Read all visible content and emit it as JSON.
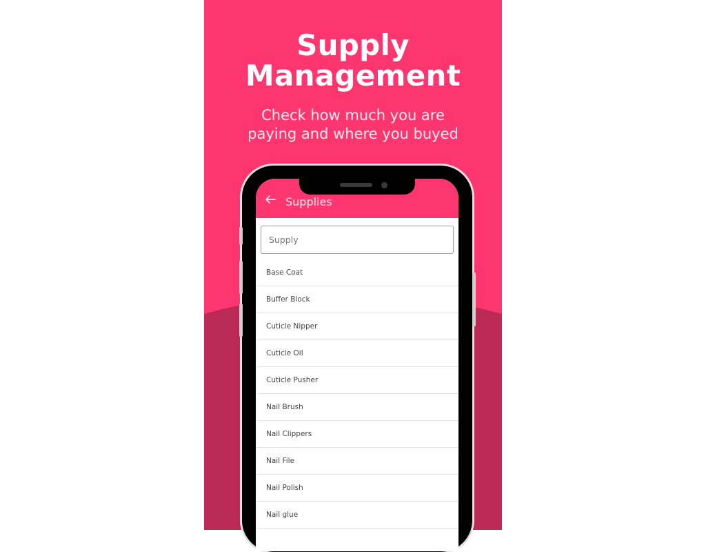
{
  "colors": {
    "primary": "#fd3670",
    "secondary_background": "#bb2a57",
    "bezel": "#000000",
    "text_on_primary": "#ffffff"
  },
  "promo": {
    "headline_line1": "Supply",
    "headline_line2": "Management",
    "subline_line1": "Check how much you are",
    "subline_line2": "paying and where you buyed"
  },
  "app": {
    "back_icon": "arrow-left-icon",
    "title": "Supplies",
    "search": {
      "value": "",
      "placeholder": "Supply"
    },
    "items": [
      {
        "label": "Base Coat"
      },
      {
        "label": "Buffer Block"
      },
      {
        "label": "Cuticle Nipper"
      },
      {
        "label": "Cuticle Oil"
      },
      {
        "label": "Cuticle Pusher"
      },
      {
        "label": "Nail Brush"
      },
      {
        "label": "Nail Clippers"
      },
      {
        "label": "Nail File"
      },
      {
        "label": "Nail Polish"
      },
      {
        "label": "Nail glue"
      }
    ]
  }
}
